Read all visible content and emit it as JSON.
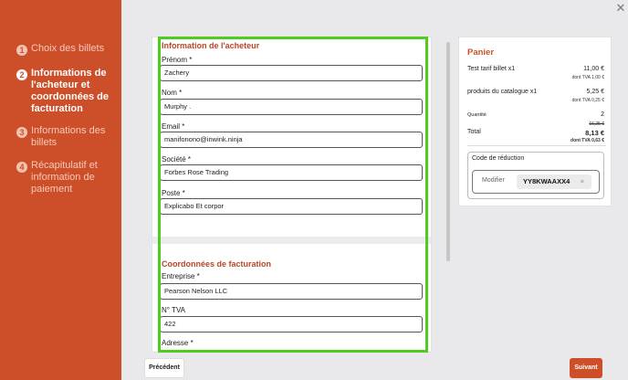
{
  "sidebar": {
    "steps": [
      {
        "num": "1",
        "label": "Choix des billets"
      },
      {
        "num": "2",
        "label": "Informations de l'acheteur et coordonnées de facturation"
      },
      {
        "num": "3",
        "label": "Informations des billets"
      },
      {
        "num": "4",
        "label": "Récapitulatif et information de paiement"
      }
    ]
  },
  "close_label": "✕",
  "buyer": {
    "title": "Information de l'acheteur",
    "fields": [
      {
        "label": "Prénom *",
        "value": "Zachery"
      },
      {
        "label": "Nom *",
        "value": "Murphy ."
      },
      {
        "label": "Email *",
        "value": "manifonono@inwink.ninja"
      },
      {
        "label": "Société *",
        "value": "Forbes Rose Trading"
      },
      {
        "label": "Poste *",
        "value": "Explicabo Et corpor"
      }
    ]
  },
  "billing": {
    "title": "Coordonnées de facturation",
    "fields": [
      {
        "label": "Entreprise *",
        "value": "Pearson Nelson LLC"
      },
      {
        "label": "N° TVA",
        "value": "422"
      },
      {
        "label": "Adresse *",
        "value": ""
      }
    ]
  },
  "panier": {
    "title": "Panier",
    "items": [
      {
        "name": "Test tarif billet  x1",
        "price": "11,00 €",
        "tax": "dont TVA 1,00 €"
      },
      {
        "name": "produits du catalogue  x1",
        "price": "5,25 €",
        "tax": "dont TVA 0,25 €"
      }
    ],
    "quantity_label": "Quantité",
    "quantity_value": "2",
    "old_total": "16,25 €",
    "total_label": "Total",
    "total_value": "8,13 €",
    "total_tax": "dont TVA 0,63 €",
    "promo_label": "Code de réduction",
    "modify_label": "Modifier",
    "promo_code": "YY8KWAAXX4",
    "remove_label": "×"
  },
  "nav": {
    "prev_label": "Précédent",
    "next_label": "Suivant"
  },
  "colors": {
    "accent": "#cd4f2a",
    "highlight": "#4fcc1f"
  }
}
